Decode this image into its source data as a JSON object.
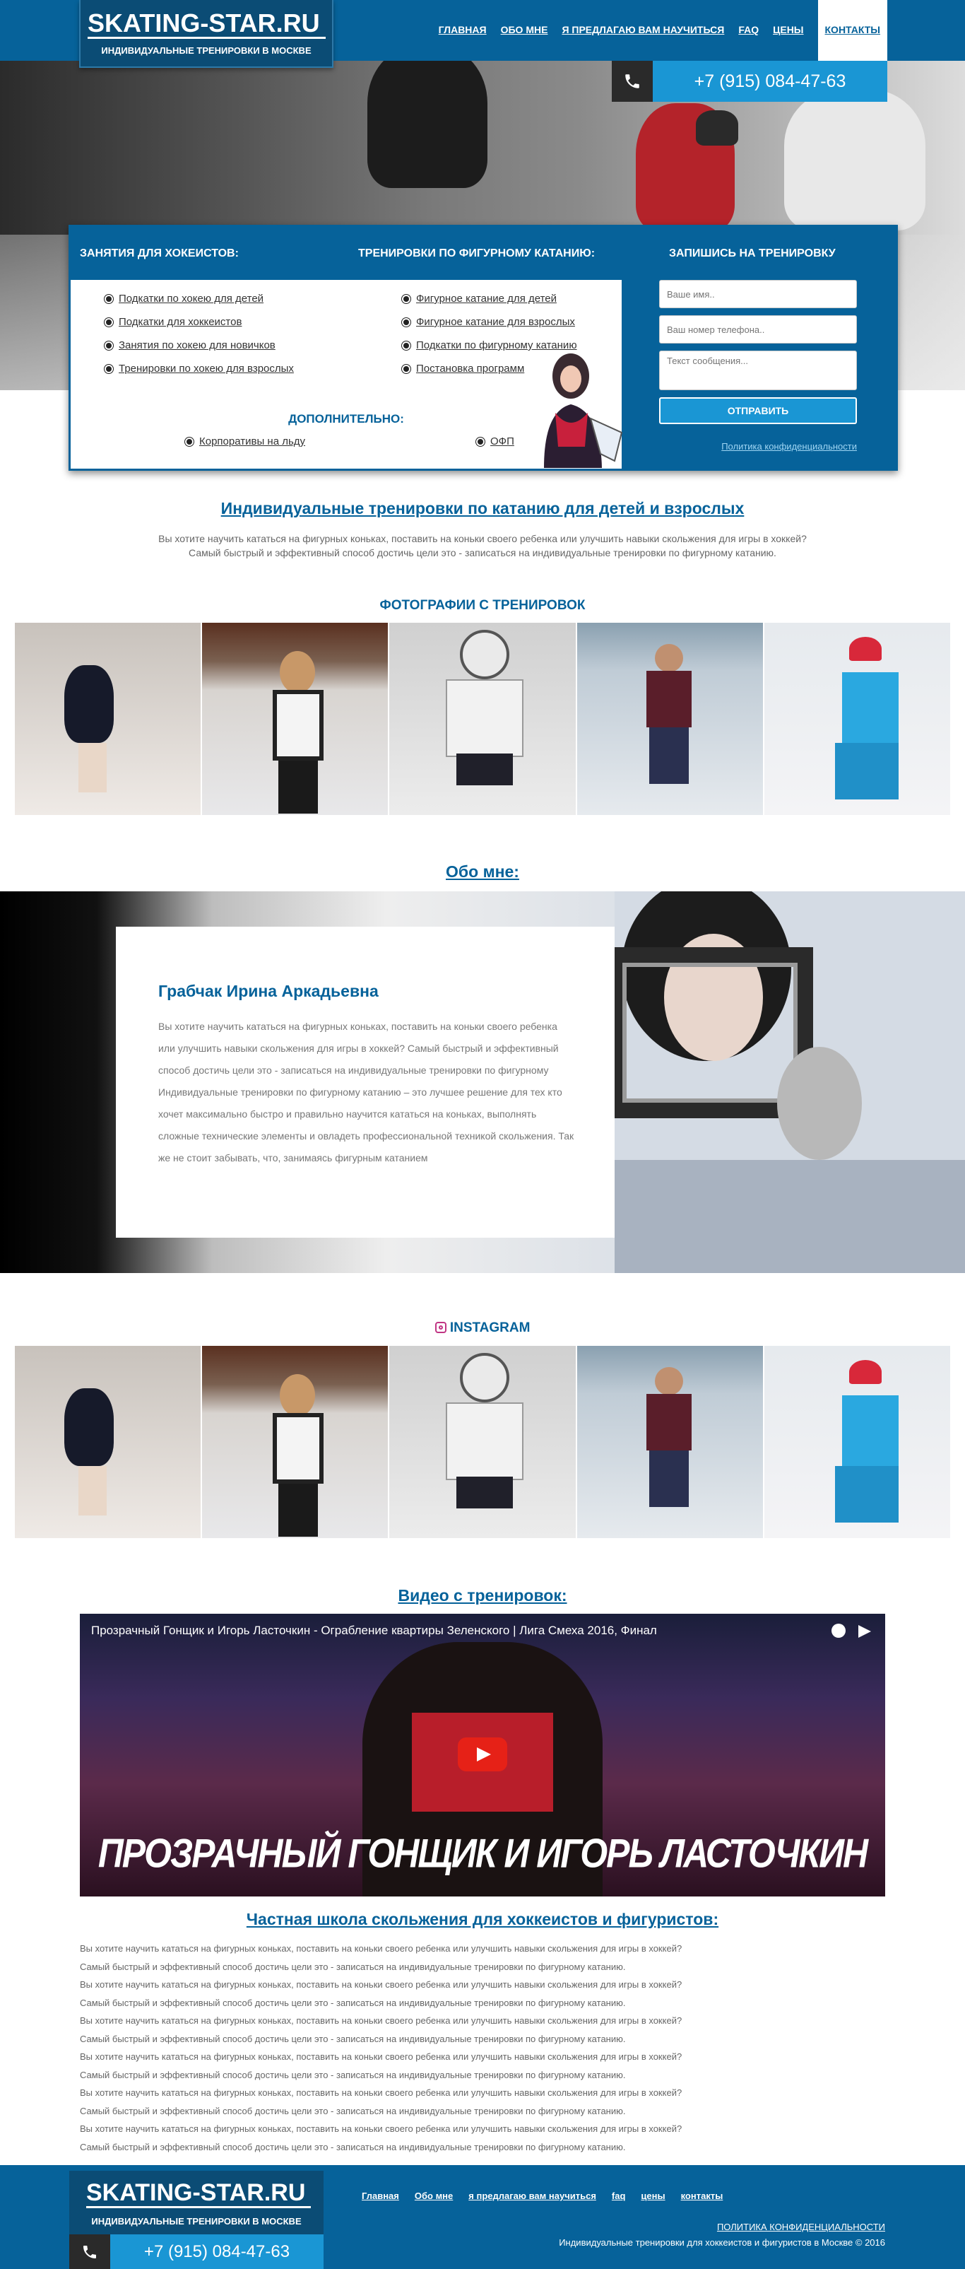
{
  "header": {
    "logo_title": "SKATING-STAR.RU",
    "logo_subtitle": "ИНДИВИДУАЛЬНЫЕ ТРЕНИРОВКИ В МОСКВЕ",
    "nav": [
      "ГЛАВНАЯ",
      "ОБО МНЕ",
      "Я ПРЕДЛАГАЮ ВАМ НАУЧИТЬСЯ",
      "FAQ",
      "ЦЕНЫ",
      "КОНТАКТЫ"
    ],
    "phone": "+7 (915) 084-47-63",
    "phone_icon": "phone-icon"
  },
  "panel": {
    "hockey_heading": "ЗАНЯТИЯ ДЛЯ ХОКЕИСТОВ:",
    "figure_heading": "ТРЕНИРОВКИ ПО ФИГУРНОМУ КАТАНИЮ:",
    "signup_heading": "ЗАПИШИСЬ НА ТРЕНИРОВКУ",
    "hockey_items": [
      "Подкатки по хокею для детей",
      "Подкатки для хоккеистов",
      "Занятия по хокею для новичков",
      "Тренировки по хокею для взрослых"
    ],
    "figure_items": [
      "Фигурное катание для детей",
      "Фигурное катание для взрослых",
      "Подкатки по фигурному катанию",
      "Постановка программ"
    ],
    "extra_heading": "ДОПОЛНИТЕЛЬНО:",
    "extra_items": [
      "Корпоративы на льду",
      "ОФП"
    ],
    "form": {
      "name_placeholder": "Ваше имя..",
      "phone_placeholder": "Ваш номер телефона..",
      "message_placeholder": "Текст сообщения...",
      "submit": "ОТПРАВИТЬ",
      "privacy": "Политика конфиденциальности"
    }
  },
  "intro": {
    "title": "Индивидуальные тренировки по катанию для детей и взрослых",
    "line1": "Вы хотите научить кататься на фигурных коньках, поставить на коньки своего ребенка или улучшить навыки скольжения для игры в хоккей?",
    "line2": "Самый быстрый и эффективный способ достичь цели это - записаться на индивидуальные тренировки по фигурному катанию."
  },
  "photos": {
    "title": "ФОТОГРАФИИ С ТРЕНИРОВОК"
  },
  "about": {
    "title": "Обо мне:",
    "name": "Грабчак Ирина Аркадьевна",
    "text": "Вы хотите научить кататься на фигурных коньках, поставить на коньки своего ребенка или улучшить навыки скольжения для игры в хоккей? Самый быстрый и эффективный способ достичь цели это - записаться на индивидуальные тренировки по фигурному Индивидуальные тренировки по фигурному катанию – это лучшее решение для тех кто хочет максимально быстро и правильно научится кататься на коньках, выполнять сложные технические элементы и овладеть профессиональной техникой скольжения. Так же не стоит забывать, что, занимаясь фигурным катанием"
  },
  "instagram": {
    "title": "INSTAGRAM",
    "icon": "instagram-icon"
  },
  "video": {
    "title": "Видео с тренировок:",
    "player_title": "Прозрачный Гонщик и Игорь Ласточкин - Ограбление квартиры Зеленского | Лига Смеха 2016, Финал",
    "caption": "ПРОЗРАЧНЫЙ ГОНЩИК И ИГОРЬ ЛАСТОЧКИН"
  },
  "school": {
    "title": "Частная школа скольжения для хоккеистов и фигуристов:",
    "lines": [
      "Вы хотите научить кататься на фигурных коньках, поставить на коньки своего ребенка или улучшить навыки скольжения для игры в хоккей?",
      "Самый быстрый и эффективный способ достичь цели это - записаться на индивидуальные тренировки по фигурному катанию.",
      "Вы хотите научить кататься на фигурных коньках, поставить на коньки своего ребенка или улучшить навыки скольжения для игры в хоккей?",
      "Самый быстрый и эффективный способ достичь цели это - записаться на индивидуальные тренировки по фигурному катанию.",
      "Вы хотите научить кататься на фигурных коньках, поставить на коньки своего ребенка или улучшить навыки скольжения для игры в хоккей?",
      "Самый быстрый и эффективный способ достичь цели это - записаться на индивидуальные тренировки по фигурному катанию.",
      "Вы хотите научить кататься на фигурных коньках, поставить на коньки своего ребенка или улучшить навыки скольжения для игры в хоккей?",
      "Самый быстрый и эффективный способ достичь цели это - записаться на индивидуальные тренировки по фигурному катанию.",
      "Вы хотите научить кататься на фигурных коньках, поставить на коньки своего ребенка или улучшить навыки скольжения для игры в хоккей?",
      "Самый быстрый и эффективный способ достичь цели это - записаться на индивидуальные тренировки по фигурному катанию.",
      "Вы хотите научить кататься на фигурных коньках, поставить на коньки своего ребенка или улучшить навыки скольжения для игры в хоккей?",
      "Самый быстрый и эффективный способ достичь цели это - записаться на индивидуальные тренировки по фигурному катанию."
    ]
  },
  "footer": {
    "logo_title": "SKATING-STAR.RU",
    "logo_subtitle": "ИНДИВИДУАЛЬНЫЕ ТРЕНИРОВКИ В МОСКВЕ",
    "nav": [
      "Главная",
      "Обо мне",
      "я предлагаю вам научиться",
      "faq",
      "цены",
      "контакты"
    ],
    "privacy": "ПОЛИТИКА КОНФИДЕНЦИАЛЬНОСТИ",
    "copyright": "Индивидуальные тренировки для хоккеистов и фигуристов в Москве © 2016",
    "phone": "+7 (915) 084-47-63"
  },
  "colors": {
    "brand": "#06629a",
    "accent": "#1a96d4",
    "dark_blue": "#0b4c75"
  }
}
